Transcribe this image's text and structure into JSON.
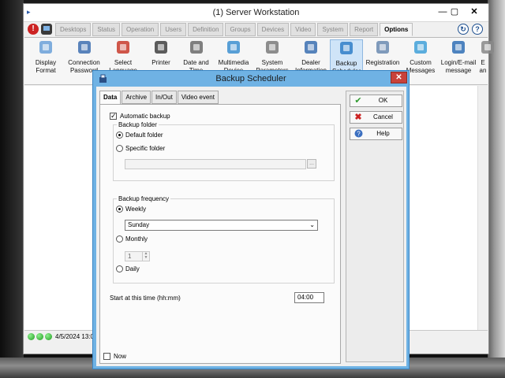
{
  "window": {
    "title": "(1)  Server Workstation"
  },
  "tabstrip": {
    "tabs": [
      {
        "label": "Desktops",
        "active": false
      },
      {
        "label": "Status",
        "active": false
      },
      {
        "label": "Operation",
        "active": false
      },
      {
        "label": "Users",
        "active": false
      },
      {
        "label": "Definition",
        "active": false
      },
      {
        "label": "Groups",
        "active": false
      },
      {
        "label": "Devices",
        "active": false
      },
      {
        "label": "Video",
        "active": false
      },
      {
        "label": "System",
        "active": false
      },
      {
        "label": "Report",
        "active": false
      },
      {
        "label": "Options",
        "active": true
      }
    ]
  },
  "ribbon": {
    "items": [
      {
        "line1": "Display",
        "line2": "Format",
        "icon": "display-format-icon"
      },
      {
        "line1": "Connection",
        "line2": "Password",
        "icon": "connection-password-icon"
      },
      {
        "line1": "Select",
        "line2": "Language",
        "icon": "language-icon"
      },
      {
        "line1": "Printer",
        "line2": "",
        "icon": "printer-icon"
      },
      {
        "line1": "Date and",
        "line2": "Time",
        "icon": "clock-icon"
      },
      {
        "line1": "Multimedia",
        "line2": "Device",
        "icon": "multimedia-icon"
      },
      {
        "line1": "System",
        "line2": "Parameters",
        "icon": "tools-icon"
      },
      {
        "line1": "Dealer",
        "line2": "Information",
        "icon": "dealer-icon"
      },
      {
        "line1": "Backup",
        "line2": "Scheduler",
        "icon": "database-icon"
      },
      {
        "line1": "Registration",
        "line2": "",
        "icon": "registration-icon"
      },
      {
        "line1": "Custom",
        "line2": "Messages",
        "icon": "messages-icon"
      },
      {
        "line1": "Login/E-mail",
        "line2": "message",
        "icon": "email-icon"
      },
      {
        "line1": "E",
        "line2": "an",
        "icon": "truncated-icon"
      }
    ]
  },
  "status": {
    "datetime": "4/5/2024 13:07"
  },
  "dialog": {
    "title": "Backup Scheduler",
    "tabs": [
      "Data",
      "Archive",
      "In/Out",
      "Video event"
    ],
    "automatic_backup": {
      "label": "Automatic backup",
      "checked": true
    },
    "backup_folder": {
      "title": "Backup folder",
      "default_label": "Default folder",
      "specific_label": "Specific folder",
      "selected": "default",
      "path_value": ""
    },
    "backup_frequency": {
      "title": "Backup frequency",
      "weekly_label": "Weekly",
      "weekday_value": "Sunday",
      "monthly_label": "Monthly",
      "monthly_day": "1",
      "daily_label": "Daily",
      "selected": "weekly"
    },
    "start_time": {
      "label": "Start at this time (hh:mm)",
      "value": "04:00"
    },
    "now": {
      "label": "Now",
      "checked": false
    },
    "buttons": {
      "ok": "OK",
      "cancel": "Cancel",
      "help": "Help"
    }
  },
  "colors": {
    "dialog_frame": "#6fb2e4",
    "close_red": "#c8423a",
    "status_green": "#2fbf2f",
    "selected_ribbon": "#cfe4f8"
  }
}
